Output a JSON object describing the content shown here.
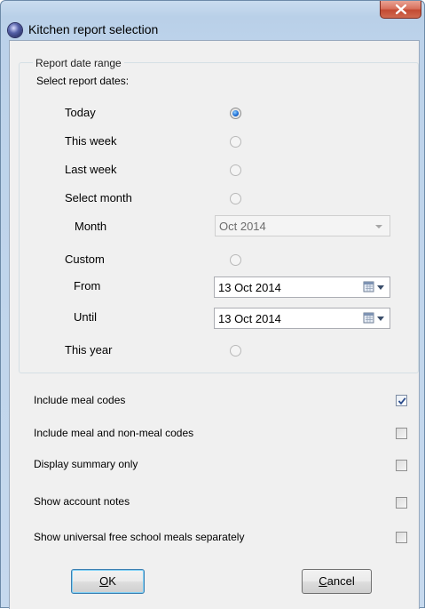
{
  "window": {
    "title": "Kitchen report selection",
    "close_symbol": "x"
  },
  "date_range": {
    "legend": "Report date range",
    "subtitle": "Select report dates:",
    "options": [
      {
        "label": "Today",
        "selected": true
      },
      {
        "label": "This week",
        "selected": false
      },
      {
        "label": "Last week",
        "selected": false
      },
      {
        "label": "Select month",
        "selected": false
      },
      {
        "label": "Custom",
        "selected": false
      },
      {
        "label": "This year",
        "selected": false
      }
    ],
    "month": {
      "label": "Month",
      "value": "Oct 2014"
    },
    "from": {
      "label": "From",
      "value": "13 Oct  2014"
    },
    "until": {
      "label": "Until",
      "value": "13 Oct  2014"
    }
  },
  "checks": [
    {
      "label": "Include meal codes",
      "checked": true
    },
    {
      "label": "Include meal and non-meal codes",
      "checked": false
    },
    {
      "label": "Display summary only",
      "checked": false
    },
    {
      "label": "Show account notes",
      "checked": false
    },
    {
      "label": "Show universal free school meals separately",
      "checked": false
    }
  ],
  "buttons": {
    "ok": {
      "mnemonic": "O",
      "rest": "K"
    },
    "cancel": {
      "mnemonic": "C",
      "rest": "ancel"
    }
  },
  "colors": {
    "frame": "#bcd2ea",
    "client": "#f0f0f0",
    "close": "#c34a33",
    "radio_selected": "#1f6fd6"
  }
}
